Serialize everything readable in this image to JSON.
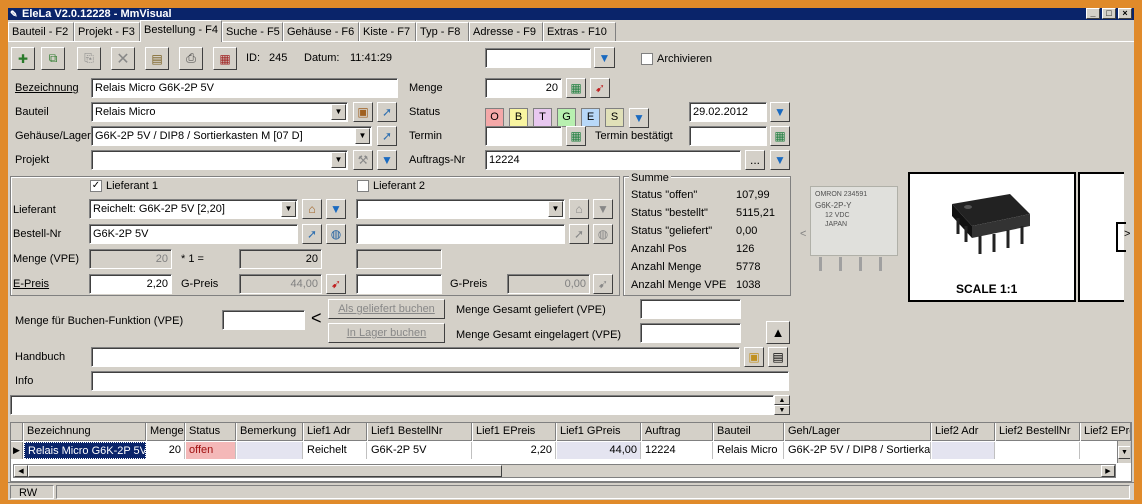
{
  "window": {
    "title": "EleLa V2.0.12228 - MmVisual"
  },
  "tabs": [
    {
      "label": "Bauteil - F2"
    },
    {
      "label": "Projekt - F3"
    },
    {
      "label": "Bestellung - F4"
    },
    {
      "label": "Suche - F5"
    },
    {
      "label": "Gehäuse - F6"
    },
    {
      "label": "Kiste - F7"
    },
    {
      "label": "Typ - F8"
    },
    {
      "label": "Adresse - F9"
    },
    {
      "label": "Extras - F10"
    }
  ],
  "toolbar": {
    "id_label": "ID:",
    "id_value": "245",
    "datum_label": "Datum:",
    "datum_value": "11:41:29",
    "archivieren_label": "Archivieren"
  },
  "form": {
    "bezeichnung_label": "Bezeichnung",
    "bezeichnung_value": "Relais Micro G6K-2P 5V",
    "bauteil_label": "Bauteil",
    "bauteil_value": "Relais Micro",
    "gehaeuse_label": "Gehäuse/Lager",
    "gehaeuse_value": "G6K-2P 5V / DIP8 / Sortierkasten M [07 D]",
    "projekt_label": "Projekt",
    "projekt_value": "",
    "menge_label": "Menge",
    "menge_value": "20",
    "status_label": "Status",
    "status_letters": [
      "O",
      "B",
      "T",
      "G",
      "E",
      "S"
    ],
    "status_colors": [
      "#f4a8a8",
      "#f8f4a0",
      "#e8c8f0",
      "#b8f0b0",
      "#b8d8f8",
      "#e0e0b8"
    ],
    "status_date": "29.02.2012",
    "termin_label": "Termin",
    "termin_value": "",
    "termin_bestaetigt_label": "Termin bestätigt",
    "termin_bestaetigt_value": "",
    "auftrags_label": "Auftrags-Nr",
    "auftrags_value": "12224",
    "browse_label": "..."
  },
  "lieferant": {
    "l1_label": "Lieferant 1",
    "l1_checked": true,
    "l2_label": "Lieferant 2",
    "l2_checked": false,
    "lieferant_label": "Lieferant",
    "lieferant_value": "Reichelt: G6K-2P 5V [2,20]",
    "bestellnr_label": "Bestell-Nr",
    "bestellnr_value": "G6K-2P 5V",
    "menge_vpe_label": "Menge (VPE)",
    "menge_vpe_value": "20",
    "mult_label": "* 1 =",
    "mult_value": "20",
    "epreis_label": "E-Preis",
    "epreis_value": "2,20",
    "gpreis_label": "G-Preis",
    "gpreis_value": "44,00",
    "gpreis2_label": "G-Preis",
    "gpreis2_value": "0,00"
  },
  "summe": {
    "title": "Summe",
    "rows": [
      {
        "label": "Status \"offen\"",
        "value": "107,99"
      },
      {
        "label": "Status \"bestellt\"",
        "value": "5115,21"
      },
      {
        "label": "Status \"geliefert\"",
        "value": "0,00"
      },
      {
        "label": "Anzahl Pos",
        "value": "126"
      },
      {
        "label": "Anzahl Menge",
        "value": "5778"
      },
      {
        "label": "Anzahl Menge VPE",
        "value": "1038"
      }
    ]
  },
  "buchen": {
    "menge_label": "Menge für Buchen-Funktion (VPE)",
    "menge_value": "",
    "arrow": "<",
    "geliefert_btn": "Als geliefert buchen",
    "lager_btn": "In Lager buchen",
    "gesamt_geliefert_label": "Menge Gesamt geliefert (VPE)",
    "gesamt_eingelagert_label": "Menge Gesamt eingelagert (VPE)"
  },
  "handbuch_label": "Handbuch",
  "info_label": "Info",
  "image_panel": {
    "relay_text_1": "OMRON 234591",
    "relay_text_2": "G6K-2P-Y",
    "relay_text_3": "12 VDC",
    "relay_text_4": "JAPAN",
    "scale_label": "SCALE 1:1",
    "prev_arrow": "<",
    "next_arrow": ">"
  },
  "grid": {
    "columns": [
      "Bezeichnung",
      "Menge",
      "Status",
      "Bemerkung",
      "Lief1 Adr",
      "Lief1 BestellNr",
      "Lief1 EPreis",
      "Lief1 GPreis",
      "Auftrag",
      "Bauteil",
      "Geh/Lager",
      "Lief2 Adr",
      "Lief2 BestellNr",
      "Lief2 EPre"
    ],
    "row": [
      "Relais Micro G6K-2P 5V",
      "20",
      "offen",
      "",
      "Reichelt",
      "G6K-2P 5V",
      "2,20",
      "44,00",
      "12224",
      "Relais Micro",
      "G6K-2P 5V / DIP8 / Sortierkas",
      "",
      "",
      ""
    ]
  },
  "statusbar": {
    "mode": "RW"
  }
}
